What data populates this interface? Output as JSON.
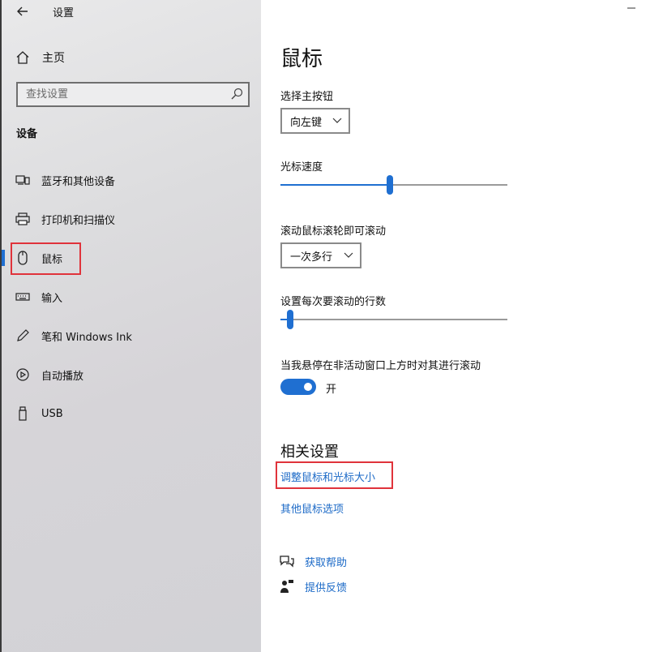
{
  "window": {
    "title": "设置",
    "back_icon": "arrow-left-icon",
    "minimize_icon": "minimize-icon"
  },
  "sidebar": {
    "home_label": "主页",
    "search_placeholder": "查找设置",
    "section_title": "设备",
    "items": [
      {
        "label": "蓝牙和其他设备",
        "icon": "bluetooth-devices-icon",
        "active": false
      },
      {
        "label": "打印机和扫描仪",
        "icon": "printer-icon",
        "active": false
      },
      {
        "label": "鼠标",
        "icon": "mouse-icon",
        "active": true
      },
      {
        "label": "输入",
        "icon": "keyboard-icon",
        "active": false
      },
      {
        "label": "笔和 Windows Ink",
        "icon": "pen-icon",
        "active": false
      },
      {
        "label": "自动播放",
        "icon": "autoplay-icon",
        "active": false
      },
      {
        "label": "USB",
        "icon": "usb-icon",
        "active": false
      }
    ]
  },
  "main": {
    "title": "鼠标",
    "primary_button": {
      "label": "选择主按钮",
      "value": "向左键"
    },
    "cursor_speed": {
      "label": "光标速度",
      "fraction": 0.48
    },
    "scroll_mode": {
      "label": "滚动鼠标滚轮即可滚动",
      "value": "一次多行"
    },
    "lines_per_scroll": {
      "label": "设置每次要滚动的行数",
      "fraction": 0.03
    },
    "inactive_scroll": {
      "label": "当我悬停在非活动窗口上方时对其进行滚动",
      "state": "开",
      "on": true
    },
    "related": {
      "title": "相关设置",
      "links": [
        "调整鼠标和光标大小",
        "其他鼠标选项"
      ]
    },
    "help": {
      "get_help": "获取帮助",
      "feedback": "提供反馈"
    }
  },
  "colors": {
    "accent": "#1f6fd1",
    "link": "#1c6ac7",
    "highlight_box": "#e0333b"
  }
}
